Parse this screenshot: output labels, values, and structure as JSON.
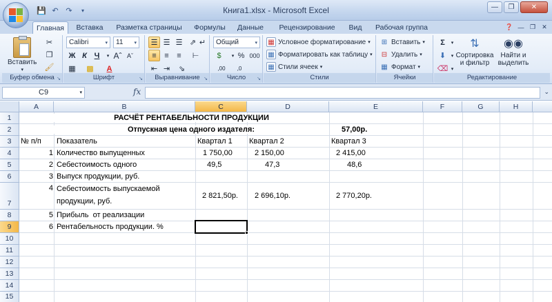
{
  "window": {
    "title": "Книга1.xlsx - Microsoft Excel"
  },
  "tabs": [
    {
      "label": "Главная",
      "active": true
    },
    {
      "label": "Вставка"
    },
    {
      "label": "Разметка страницы"
    },
    {
      "label": "Формулы"
    },
    {
      "label": "Данные"
    },
    {
      "label": "Рецензирование"
    },
    {
      "label": "Вид"
    },
    {
      "label": "Рабочая группа"
    }
  ],
  "ribbon": {
    "clipboard": {
      "label": "Буфер обмена",
      "paste": "Вставить"
    },
    "font": {
      "label": "Шрифт",
      "font_name": "Calibri",
      "font_size": "11",
      "bold": "Ж",
      "italic": "К",
      "underline": "Ч"
    },
    "alignment": {
      "label": "Выравнивание"
    },
    "number": {
      "label": "Число",
      "format": "Общий",
      "percent": "%",
      "thousands": "000"
    },
    "styles": {
      "label": "Стили",
      "conditional": "Условное форматирование",
      "table": "Форматировать как таблицу",
      "cell_styles": "Стили ячеек"
    },
    "cells": {
      "label": "Ячейки",
      "insert": "Вставить",
      "delete": "Удалить",
      "format": "Формат"
    },
    "editing": {
      "label": "Редактирование",
      "sort_line1": "Сортировка",
      "sort_line2": "и фильтр",
      "find_line1": "Найти и",
      "find_line2": "выделить"
    }
  },
  "formula_bar": {
    "name_box": "C9",
    "fx": "fx",
    "value": ""
  },
  "columns": [
    "A",
    "B",
    "C",
    "D",
    "E",
    "F",
    "G",
    "H"
  ],
  "selected_column": "C",
  "rows": [
    "1",
    "2",
    "3",
    "4",
    "5",
    "6",
    "7",
    "8",
    "9",
    "10",
    "11",
    "12",
    "13",
    "14",
    "15"
  ],
  "selected_row": "9",
  "sheet": {
    "title": "РАСЧЁТ РЕНТАБЕЛЬНОСТИ ПРОДУКЦИИ",
    "price_label": "Отпускная цена одного издателя:",
    "price_value": "57,00р.",
    "headers": {
      "num": "№ п/п",
      "indicator": "Показатель",
      "q1": "Квартал 1",
      "q2": "Квартал 2",
      "q3": "Квартал 3"
    },
    "data": [
      {
        "num": "1",
        "name": "Количество выпущенных",
        "q1": "1 750,00",
        "q2": "2 150,00",
        "q3": "2 415,00"
      },
      {
        "num": "2",
        "name": "Себестоимость одного",
        "q1": "49,5",
        "q2": "47,3",
        "q3": "48,6"
      },
      {
        "num": "3",
        "name": "Выпуск продукции, руб.",
        "q1": "",
        "q2": "",
        "q3": ""
      },
      {
        "num": "4",
        "name_line1": "Себестоимость выпускаемой",
        "name_line2": "продукции, руб.",
        "q1": "2 821,50р.",
        "q2": "2 696,10р.",
        "q3": "2 770,20р."
      },
      {
        "num": "5",
        "name": "Прибыль  от реализации",
        "q1": "",
        "q2": "",
        "q3": ""
      },
      {
        "num": "6",
        "name": "Рентабельность продукции. %",
        "q1": "",
        "q2": "",
        "q3": ""
      }
    ]
  }
}
